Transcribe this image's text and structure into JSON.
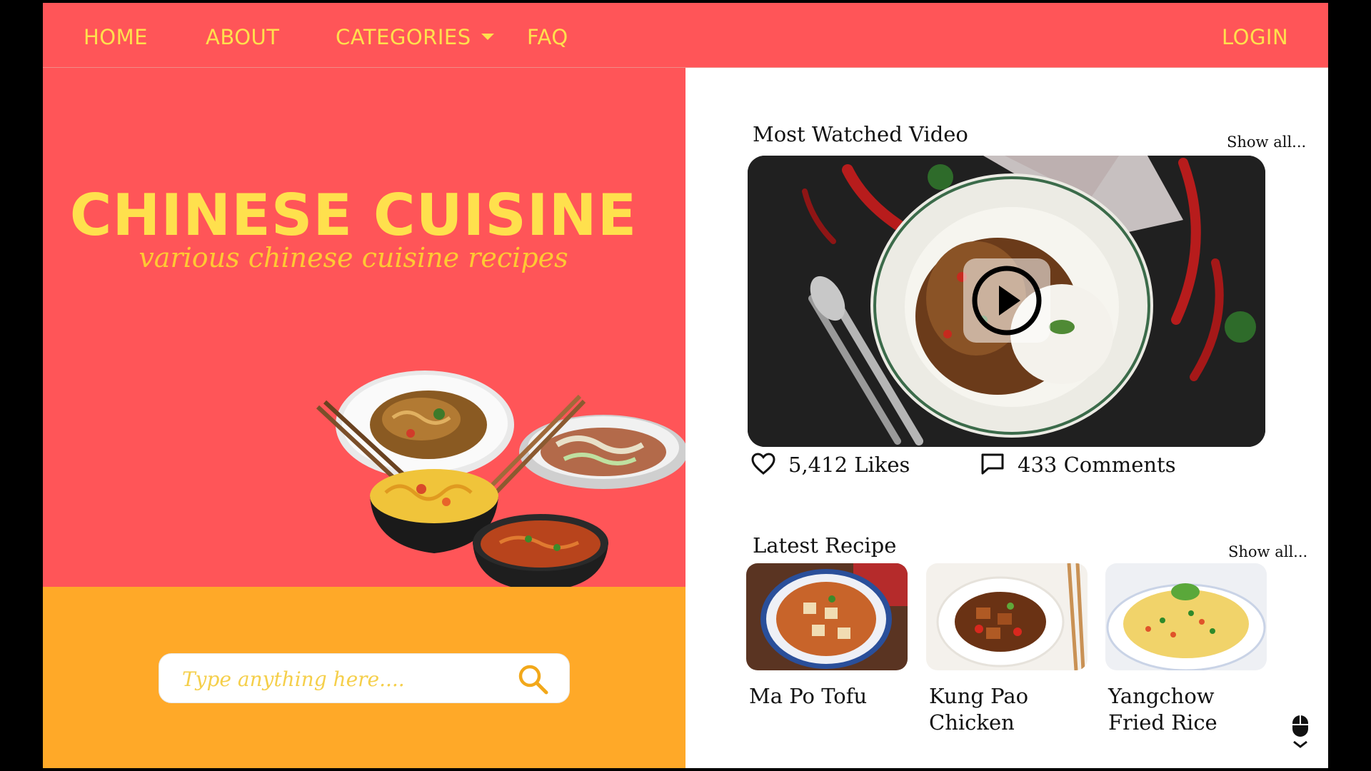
{
  "nav": {
    "home": "HOME",
    "about": "ABOUT",
    "categories": "CATEGORIES",
    "faq": "FAQ",
    "login": "LOGIN"
  },
  "hero": {
    "title": "CHINESE CUISINE",
    "subtitle": "various chinese cuisine recipes"
  },
  "search": {
    "placeholder": "Type anything here...."
  },
  "video_section": {
    "title": "Most Watched Video",
    "show_all": "Show all...",
    "likes": "5,412 Likes",
    "comments": "433 Comments"
  },
  "recipe_section": {
    "title": "Latest Recipe",
    "show_all": "Show all...",
    "items": [
      {
        "name": "Ma Po Tofu"
      },
      {
        "name": "Kung Pao Chicken"
      },
      {
        "name": "Yangchow Fried Rice"
      }
    ]
  },
  "colors": {
    "primary": "#ff5558",
    "accent": "#ffe04d",
    "search_bg": "#ffa928"
  },
  "icons": {
    "categories_caret": "chevron-down-icon",
    "search": "search-icon",
    "play": "play-icon",
    "likes": "heart-icon",
    "comments": "comment-icon",
    "scroll": "mouse-scroll-icon"
  }
}
